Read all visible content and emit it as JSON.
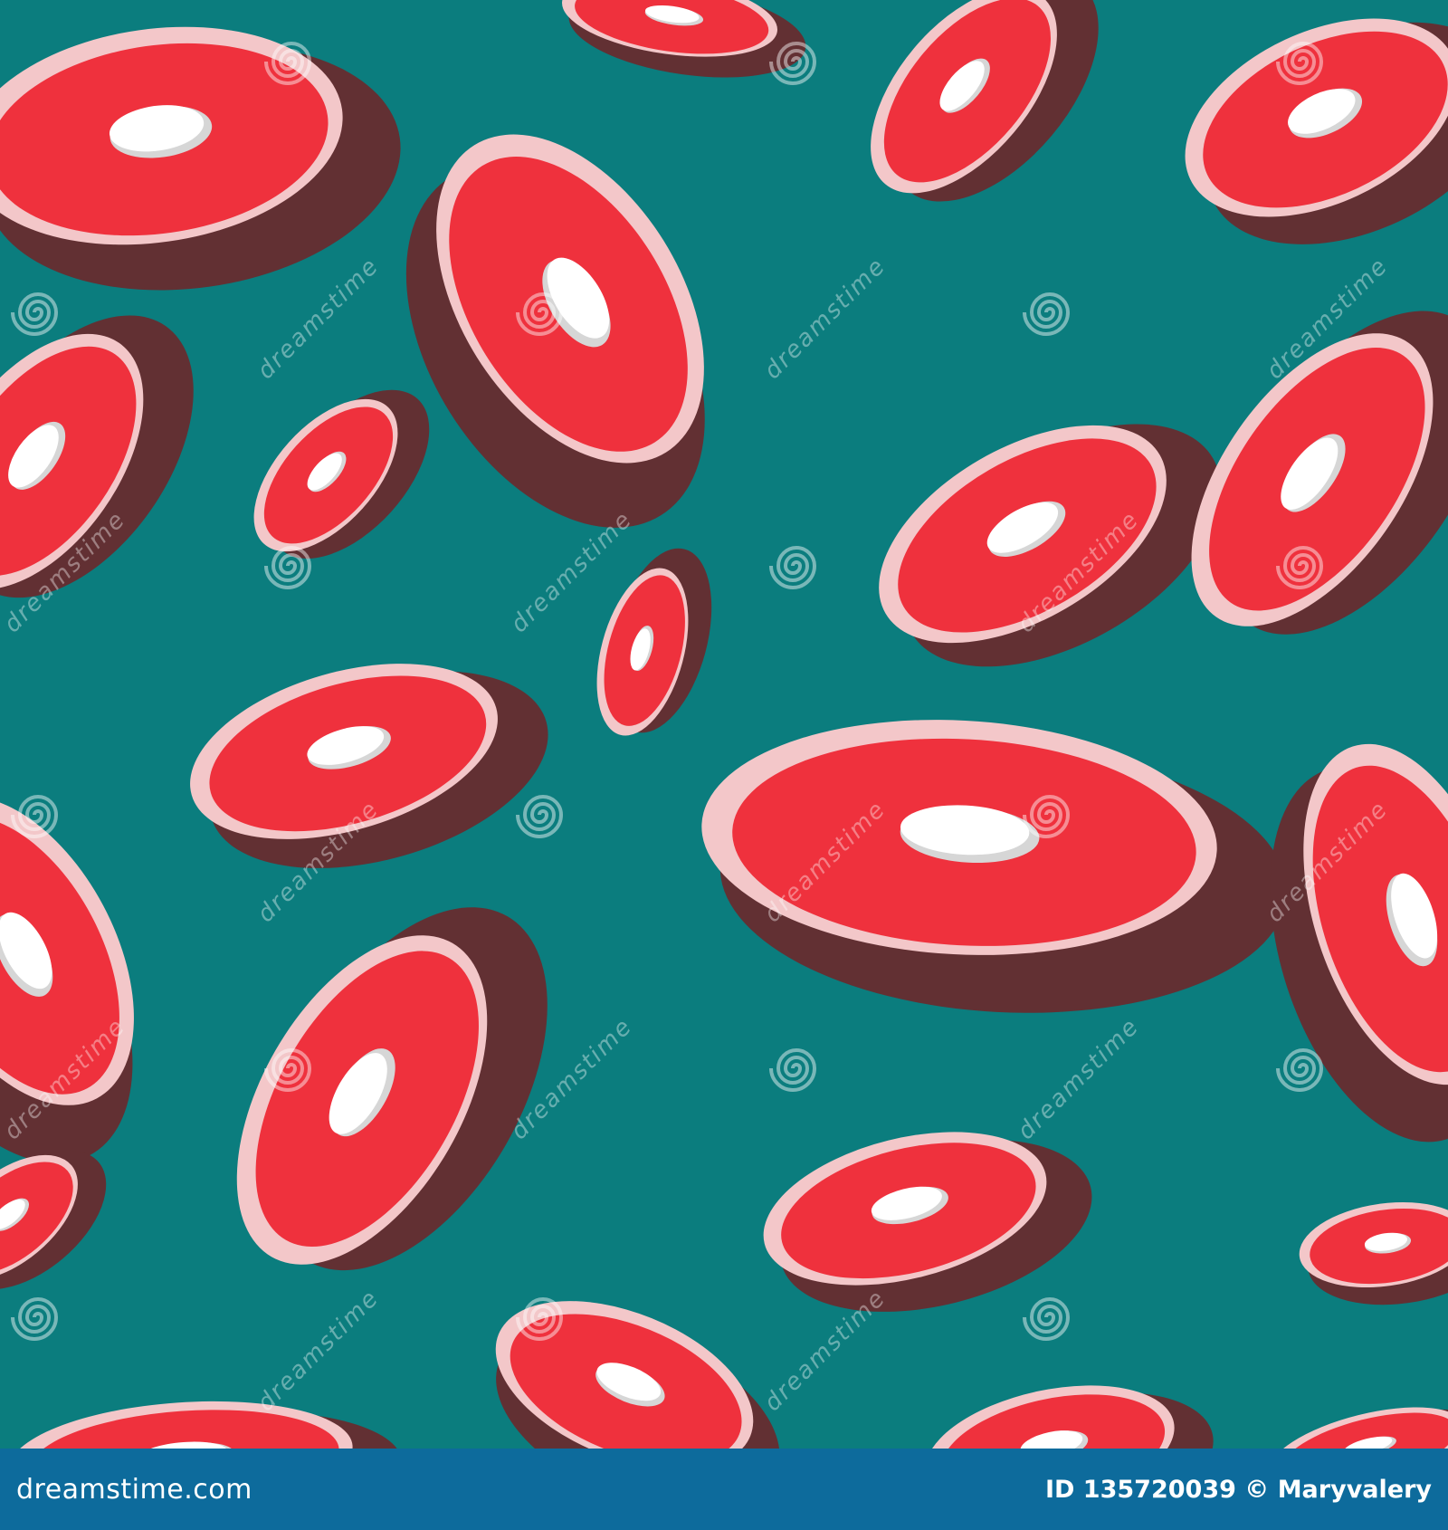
{
  "image": {
    "description": "seamless pattern of raw meat steaks",
    "background_color": "#0b7d7e",
    "steak_colors": {
      "side": "#623033",
      "rim": "#f3c7c9",
      "flesh": "#ef313d",
      "fat": "#ffffff",
      "fat_shadow": "#d6d6d6"
    }
  },
  "watermark": {
    "site_text": "dreamstime"
  },
  "footer": {
    "site": "dreamstime.com",
    "credit": "ID 135720039 © Maryvalery",
    "bar_color": "#0d6b9c"
  }
}
